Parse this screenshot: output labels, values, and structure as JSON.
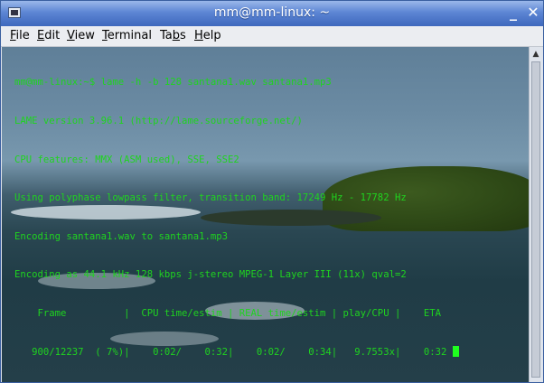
{
  "window": {
    "title": "mm@mm-linux: ~",
    "minimize_glyph": "_",
    "close_glyph": "✕"
  },
  "menu": {
    "file": {
      "mnemonic": "F",
      "rest": "ile"
    },
    "edit": {
      "mnemonic": "E",
      "rest": "dit"
    },
    "view": {
      "mnemonic": "V",
      "rest": "iew"
    },
    "terminal": {
      "mnemonic": "T",
      "rest": "erminal"
    },
    "tabs": {
      "before": "Ta",
      "mnemonic": "b",
      "rest": "s"
    },
    "help": {
      "mnemonic": "H",
      "rest": "elp"
    }
  },
  "terminal": {
    "lines": [
      "mm@mm-linux:~$ lame -h -b 128 santana1.wav santana1.mp3",
      "LAME version 3.96.1 (http://lame.sourceforge.net/)",
      "CPU features: MMX (ASM used), SSE, SSE2",
      "Using polyphase lowpass filter, transition band: 17249 Hz - 17782 Hz",
      "Encoding santana1.wav to santana1.mp3",
      "Encoding as 44.1 kHz 128 kbps j-stereo MPEG-1 Layer III (11x) qval=2",
      "    Frame          |  CPU time/estim | REAL time/estim | play/CPU |    ETA",
      "   900/12237  ( 7%)|    0:02/    0:32|    0:02/    0:34|   9.7553x|    0:32 "
    ]
  },
  "colors": {
    "terminal_text": "#1fd41f",
    "titlebar": "#5d86d4"
  },
  "icons": [
    "app-icon",
    "minimize-icon",
    "close-icon",
    "scroll-up-arrow-icon"
  ]
}
